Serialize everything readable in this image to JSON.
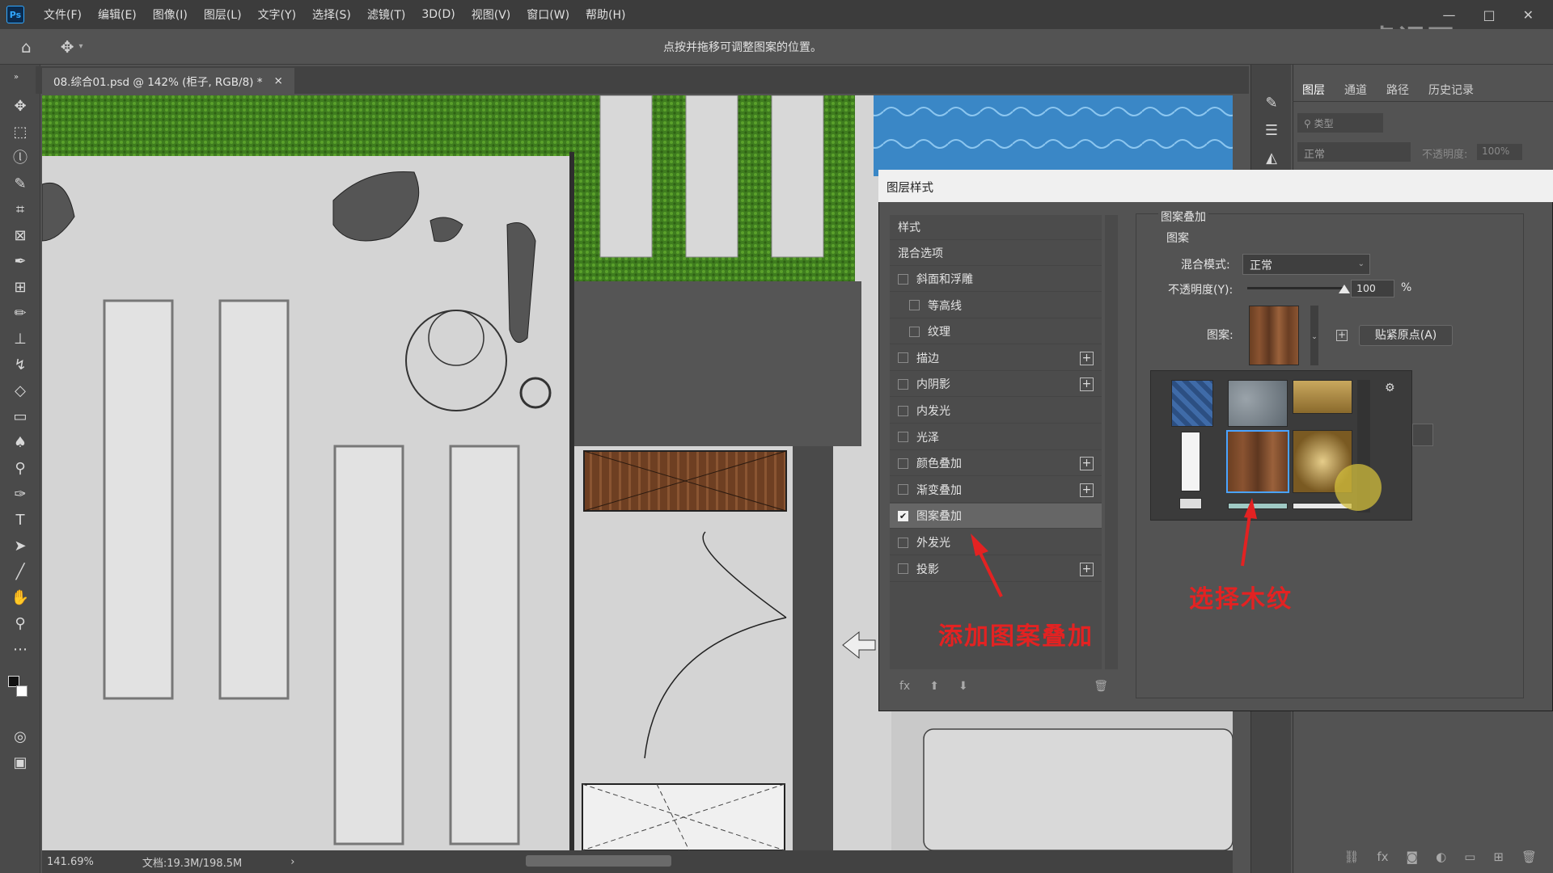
{
  "app": {
    "logo": "Ps",
    "menu": [
      "文件(F)",
      "编辑(E)",
      "图像(I)",
      "图层(L)",
      "文字(Y)",
      "选择(S)",
      "滤镜(T)",
      "3D(D)",
      "视图(V)",
      "窗口(W)",
      "帮助(H)"
    ],
    "window_controls": [
      "—",
      "□",
      "✕"
    ]
  },
  "options_bar": {
    "hint": "点按并拖移可调整图案的位置。"
  },
  "document": {
    "tab_title": "08.综合01.psd @ 142% (柜子, RGB/8) *",
    "tab_close": "×",
    "zoom": "141.69%",
    "doc_size": "文档:19.3M/198.5M",
    "status_arrow": "›"
  },
  "layers_panel": {
    "tabs": [
      "图层",
      "通道",
      "路径",
      "历史记录"
    ],
    "search_placeholder": "类型",
    "blend": "正常",
    "opacity_label": "不透明度:",
    "opacity": "100%"
  },
  "dialog": {
    "title": "图层样式",
    "list_header": "样式",
    "blend_options": "混合选项",
    "styles": [
      {
        "label": "斜面和浮雕",
        "checked": false,
        "sub": false,
        "plus": false
      },
      {
        "label": "等高线",
        "checked": false,
        "sub": true,
        "plus": false
      },
      {
        "label": "纹理",
        "checked": false,
        "sub": true,
        "plus": false
      },
      {
        "label": "描边",
        "checked": false,
        "sub": false,
        "plus": true
      },
      {
        "label": "内阴影",
        "checked": false,
        "sub": false,
        "plus": true
      },
      {
        "label": "内发光",
        "checked": false,
        "sub": false,
        "plus": false
      },
      {
        "label": "光泽",
        "checked": false,
        "sub": false,
        "plus": false
      },
      {
        "label": "颜色叠加",
        "checked": false,
        "sub": false,
        "plus": true
      },
      {
        "label": "渐变叠加",
        "checked": false,
        "sub": false,
        "plus": true
      },
      {
        "label": "图案叠加",
        "checked": true,
        "sub": false,
        "plus": false
      },
      {
        "label": "外发光",
        "checked": false,
        "sub": false,
        "plus": false
      },
      {
        "label": "投影",
        "checked": false,
        "sub": false,
        "plus": true
      }
    ],
    "footer": {
      "fx": "fx",
      "up": "⬆",
      "down": "⬇",
      "trash": "🗑"
    },
    "pane": {
      "group_title": "图案叠加",
      "sub_title": "图案",
      "blend_label": "混合模式:",
      "blend_value": "正常",
      "opacity_label": "不透明度(Y):",
      "opacity_value": "100",
      "opacity_unit": "%",
      "opacity_level": 1.0,
      "pattern_label": "图案:",
      "snap_button": "贴紧原点(A)"
    }
  },
  "annotations": {
    "add_pattern": "添加图案叠加",
    "choose_wood": "选择木纹"
  },
  "watermark": "虎课网",
  "colors": {
    "accent_red": "#e32222",
    "selection_blue": "#4aa3ff",
    "ps_blue": "#31a8ff"
  }
}
